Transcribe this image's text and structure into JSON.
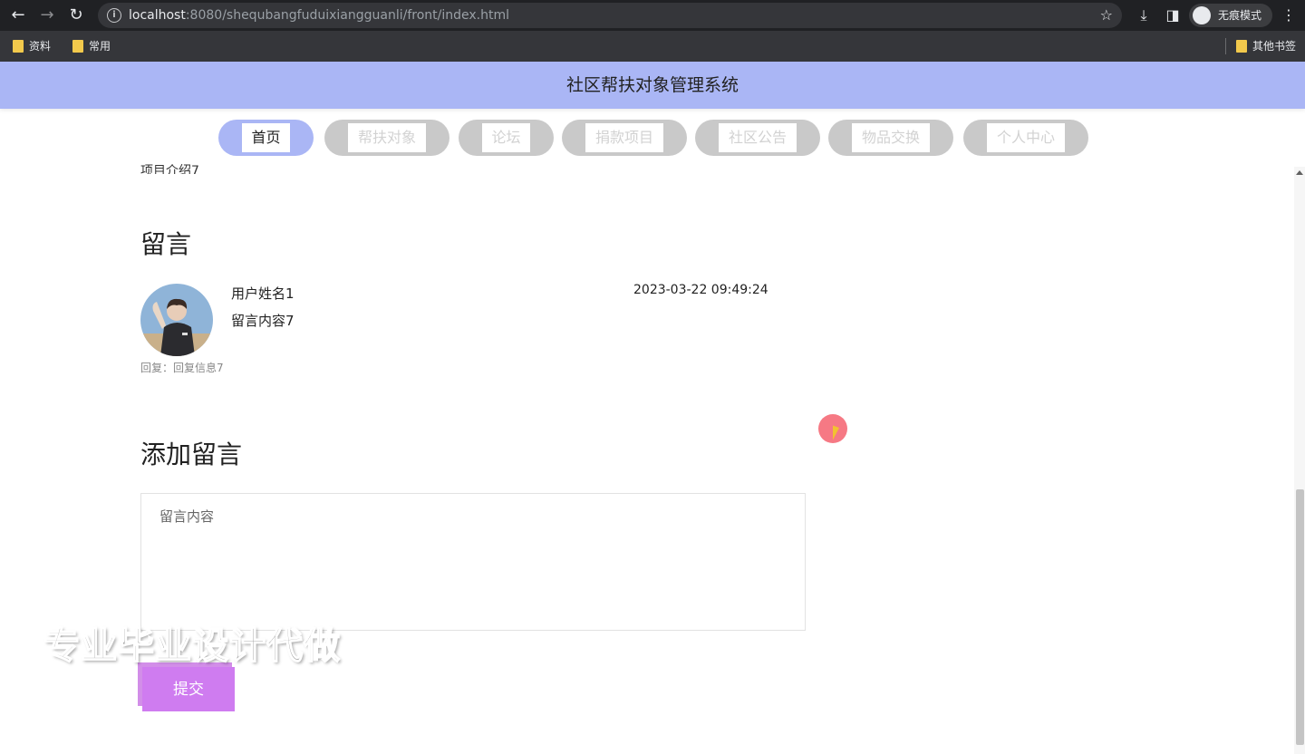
{
  "browser": {
    "url_host": "localhost",
    "url_rest": ":8080/shequbangfuduixiangguanli/front/index.html",
    "incognito_label": "无痕模式",
    "bookmarks": [
      "资料",
      "常用"
    ],
    "other_bookmarks": "其他书签"
  },
  "header": {
    "title": "社区帮扶对象管理系统"
  },
  "nav": {
    "items": [
      {
        "label": "首页",
        "active": true
      },
      {
        "label": "帮扶对象"
      },
      {
        "label": "论坛"
      },
      {
        "label": "捐款项目"
      },
      {
        "label": "社区公告"
      },
      {
        "label": "物品交换"
      },
      {
        "label": "个人中心"
      }
    ]
  },
  "content": {
    "cut_text": "项目介绍7",
    "messages_heading": "留言",
    "message": {
      "user": "用户姓名1",
      "content": "留言内容7",
      "time": "2023-03-22 09:49:24",
      "reply_label": "回复：",
      "reply_text": "回复信息7"
    },
    "add_heading": "添加留言",
    "input_placeholder": "留言内容",
    "submit_label": "提交"
  },
  "overlay": {
    "watermark": "专业毕业设计代做"
  },
  "colors": {
    "header_bg": "#aab6f5",
    "nav_inactive": "#c9c9c9",
    "submit": "#cf7cf0"
  }
}
